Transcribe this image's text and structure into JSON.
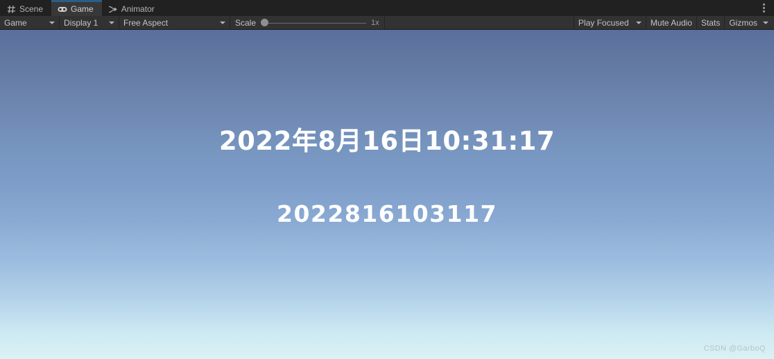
{
  "window": {
    "tabs": [
      {
        "label": "Scene",
        "icon": "grid-icon",
        "active": false
      },
      {
        "label": "Game",
        "icon": "gamepad-icon",
        "active": true
      },
      {
        "label": "Animator",
        "icon": "animator-icon",
        "active": false
      }
    ],
    "overflow_menu_icon": "kebab-menu-icon"
  },
  "toolbar": {
    "target_display_group": "Game",
    "display": "Display 1",
    "aspect": "Free Aspect",
    "scale_label": "Scale",
    "scale_value": "1x",
    "play_mode": "Play Focused",
    "mute_audio": "Mute Audio",
    "stats": "Stats",
    "gizmos": "Gizmos"
  },
  "gameview": {
    "datetime_text": "2022年8月16日10:31:17",
    "stamp_text": "2022816103117",
    "watermark": "CSDN @GarboQ",
    "sky_top_color": "#5a6f9c",
    "sky_mid_color": "#7b9ccb",
    "sky_bottom_color": "#daf2f4",
    "text_color": "#ffffff"
  },
  "theme": {
    "tabbar_bg": "#212121",
    "tab_active_bg": "#383838",
    "tab_accent": "#2c5d87",
    "toolbar_bg": "#323232",
    "text_color": "#c4c4c4"
  }
}
